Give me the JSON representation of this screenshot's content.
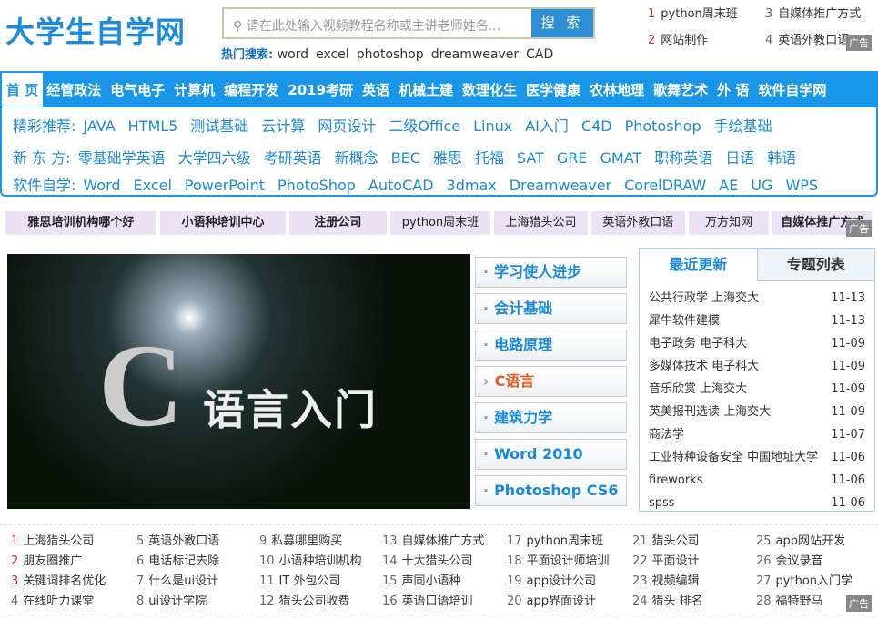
{
  "logo": "大学生自学网",
  "search": {
    "placeholder": "请在此处输入视频教程名称或主讲老师姓名...",
    "button": "搜 索",
    "icon": "search-icon"
  },
  "hot": {
    "label": "热门搜索:",
    "items": [
      "word",
      "excel",
      "photoshop",
      "dreamweaver",
      "CAD"
    ]
  },
  "top_links": [
    {
      "n": "1",
      "t": "python周末班"
    },
    {
      "n": "3",
      "t": "自媒体推广方式"
    },
    {
      "n": "2",
      "t": "网站制作"
    },
    {
      "n": "4",
      "t": "英语外教口语"
    }
  ],
  "ad_label": "广告",
  "nav": [
    "首 页",
    "经管政法",
    "电气电子",
    "计算机",
    "编程开发",
    "2019考研",
    "英语",
    "机械土建",
    "数理化生",
    "医学健康",
    "农林地理",
    "歌舞艺术",
    "外 语",
    "软件自学网"
  ],
  "rows": [
    {
      "label": "精彩推荐:",
      "items": [
        "JAVA",
        "HTML5",
        "测试基础",
        "云计算",
        "网页设计",
        "二级Office",
        "Linux",
        "AI入门",
        "C4D",
        "Photoshop",
        "手绘基础"
      ]
    },
    {
      "label": "新 东 方:",
      "items": [
        "零基础学英语",
        "大学四六级",
        "考研英语",
        "新概念",
        "BEC",
        "雅思",
        "托福",
        "SAT",
        "GRE",
        "GMAT",
        "职称英语",
        "日语",
        "韩语"
      ]
    },
    {
      "label": "软件自学:",
      "items": [
        "Word",
        "Excel",
        "PowerPoint",
        "PhotoShop",
        "AutoCAD",
        "3dmax",
        "Dreamweaver",
        "CorelDRAW",
        "AE",
        "UG",
        "WPS"
      ]
    }
  ],
  "adbar": [
    "雅思培训机构哪个好",
    "小语种培训中心",
    "注册公司",
    "python周末班",
    "上海猎头公司",
    "英语外教口语",
    "万方知网",
    "自媒体推广方式"
  ],
  "banner": {
    "c": "C",
    "title": "语言入门"
  },
  "menu": [
    "学习使人进步",
    "会计基础",
    "电路原理",
    "C语言",
    "建筑力学",
    "Word 2010",
    "Photoshop CS6"
  ],
  "side": {
    "tabs": [
      "最近更新",
      "专题列表"
    ],
    "items": [
      [
        "公共行政学 上海交大",
        "11-13"
      ],
      [
        "犀牛软件建模",
        "11-13"
      ],
      [
        "电子政务 电子科大",
        "11-09"
      ],
      [
        "多媒体技术 电子科大",
        "11-09"
      ],
      [
        "音乐欣赏 上海交大",
        "11-09"
      ],
      [
        "英美报刊选读 上海交大",
        "11-09"
      ],
      [
        "商法学",
        "11-07"
      ],
      [
        "工业特种设备安全 中国地址大学（北",
        "11-06"
      ],
      [
        "fireworks",
        "11-06"
      ],
      [
        "spss",
        "11-06"
      ]
    ]
  },
  "bottom": [
    [
      [
        "1",
        "上海猎头公司"
      ],
      [
        "2",
        "朋友圈推广"
      ],
      [
        "3",
        "关键词排名优化"
      ],
      [
        "4",
        "在线听力课堂"
      ]
    ],
    [
      [
        "5",
        "英语外教口语"
      ],
      [
        "6",
        "电话标记去除"
      ],
      [
        "7",
        "什么是ui设计"
      ],
      [
        "8",
        "ui设计学院"
      ]
    ],
    [
      [
        "9",
        "私募哪里购买"
      ],
      [
        "10",
        "小语种培训机构"
      ],
      [
        "11",
        "IT 外包公司"
      ],
      [
        "12",
        "猎头公司收费"
      ]
    ],
    [
      [
        "13",
        "自媒体推广方式"
      ],
      [
        "14",
        "十大猎头公司"
      ],
      [
        "15",
        "声同小语种"
      ],
      [
        "16",
        "英语口语培训"
      ]
    ],
    [
      [
        "17",
        "python周末班"
      ],
      [
        "18",
        "平面设计师培训"
      ],
      [
        "19",
        "app设计公司"
      ],
      [
        "20",
        "app界面设计"
      ]
    ],
    [
      [
        "21",
        "猎头公司"
      ],
      [
        "22",
        "平面设计"
      ],
      [
        "23",
        "视频编辑"
      ],
      [
        "24",
        "猎头 排名"
      ]
    ],
    [
      [
        "25",
        "app网站开发"
      ],
      [
        "26",
        "会议录音"
      ],
      [
        "27",
        "python入门学"
      ],
      [
        "28",
        "福特野马"
      ]
    ]
  ]
}
